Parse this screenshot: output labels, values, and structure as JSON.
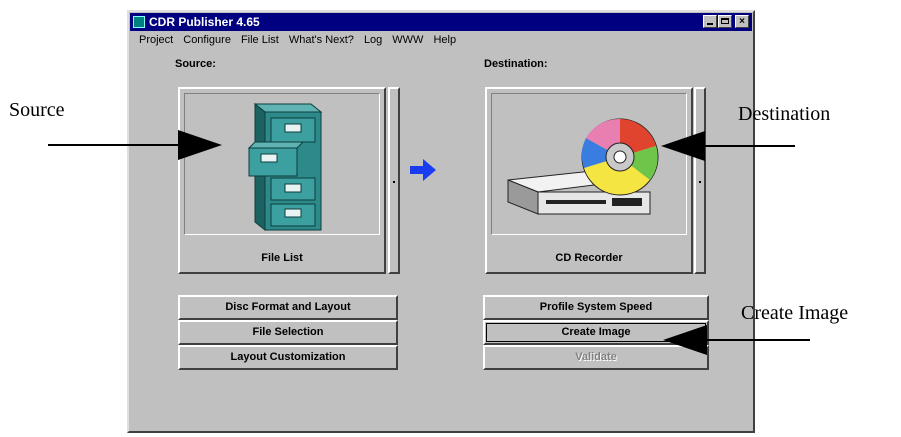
{
  "window": {
    "title": "CDR Publisher 4.65"
  },
  "menu": [
    "Project",
    "Configure",
    "File List",
    "What's Next?",
    "Log",
    "WWW",
    "Help"
  ],
  "source": {
    "label": "Source:",
    "panel_caption": "File List"
  },
  "destination": {
    "label": "Destination:",
    "panel_caption": "CD Recorder"
  },
  "left_buttons": [
    "Disc Format and Layout",
    "File Selection",
    "Layout Customization"
  ],
  "right_buttons": [
    "Profile System Speed",
    "Create Image",
    "Validate"
  ],
  "annotations": {
    "source": "Source",
    "destination": "Destination",
    "create_image": "Create Image"
  },
  "colors": {
    "title_bar": "#000080",
    "window_face": "#c0c0c0",
    "arrow_blue": "#1a3cf0",
    "cabinet_teal": "#2e8a8a"
  },
  "icons": {
    "source_panel": "file-cabinet-icon",
    "destination_panel": "cd-recorder-icon",
    "flow": "right-arrow-icon"
  }
}
